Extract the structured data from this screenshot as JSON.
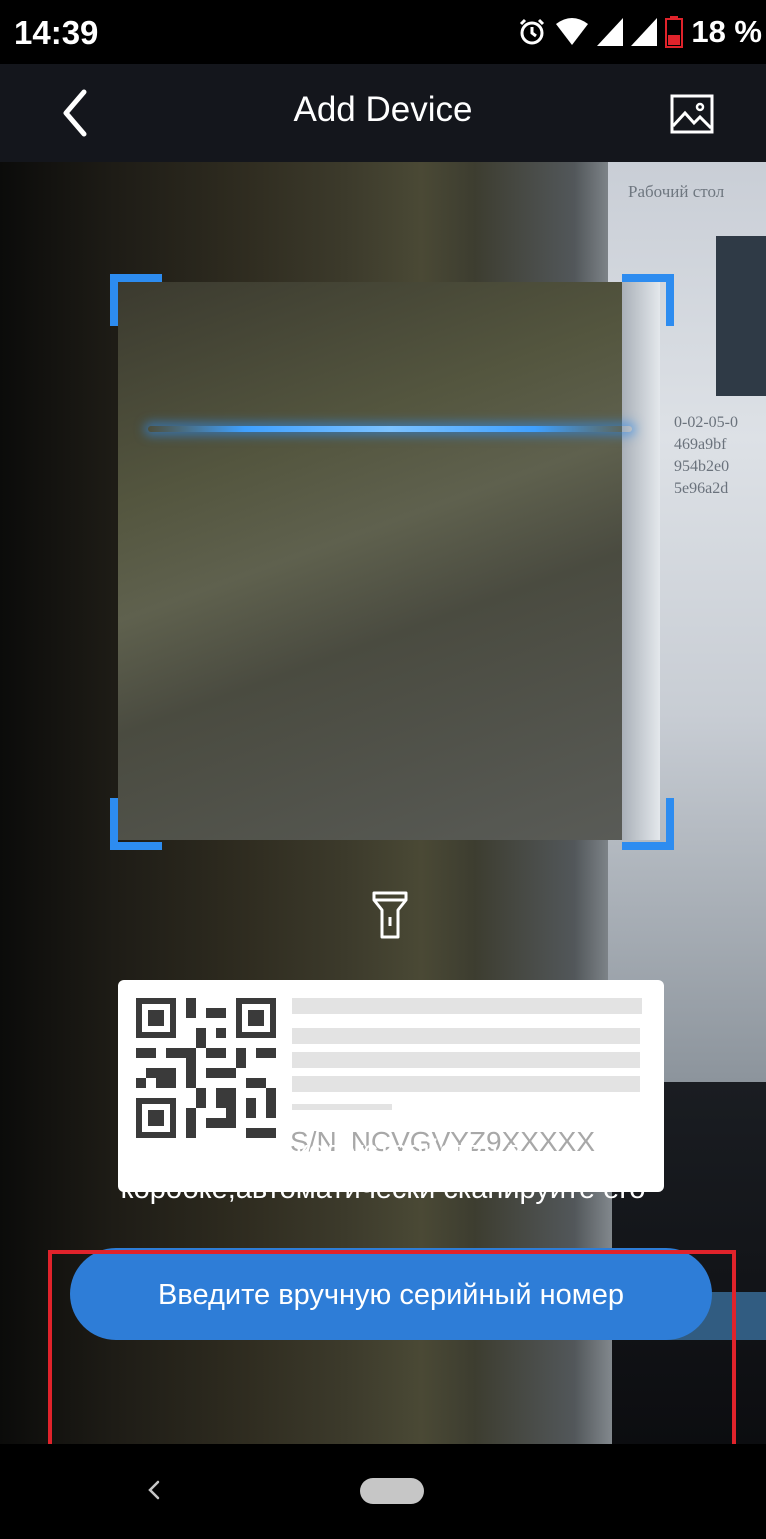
{
  "status_bar": {
    "time": "14:39",
    "battery": "18 %",
    "icons": [
      "alarm-icon",
      "wifi-icon",
      "signal-icon",
      "signal-icon",
      "battery-low-icon"
    ]
  },
  "app_bar": {
    "title": "Add Device",
    "back_icon": "chevron-left-icon",
    "gallery_icon": "image-icon"
  },
  "camera_view": {
    "background_text": "Рабочий стол",
    "background_lines": [
      "0-02-05-0",
      "469a9bf",
      "954b2e0",
      "5e96a2d"
    ]
  },
  "scanner": {
    "flashlight_icon": "flashlight-icon",
    "accent_color": "#2d8cf0"
  },
  "sample_label": {
    "sn_prefix": "S/N",
    "sn_value": "NCVGVYZ9XXXXX"
  },
  "hint_text": "QR код устройства в коробке,автоматически сканируйте его",
  "manual_button": {
    "label": "Введите вручную серийный номер",
    "color": "#2e7dd7"
  },
  "highlight_color": "#e0232b"
}
